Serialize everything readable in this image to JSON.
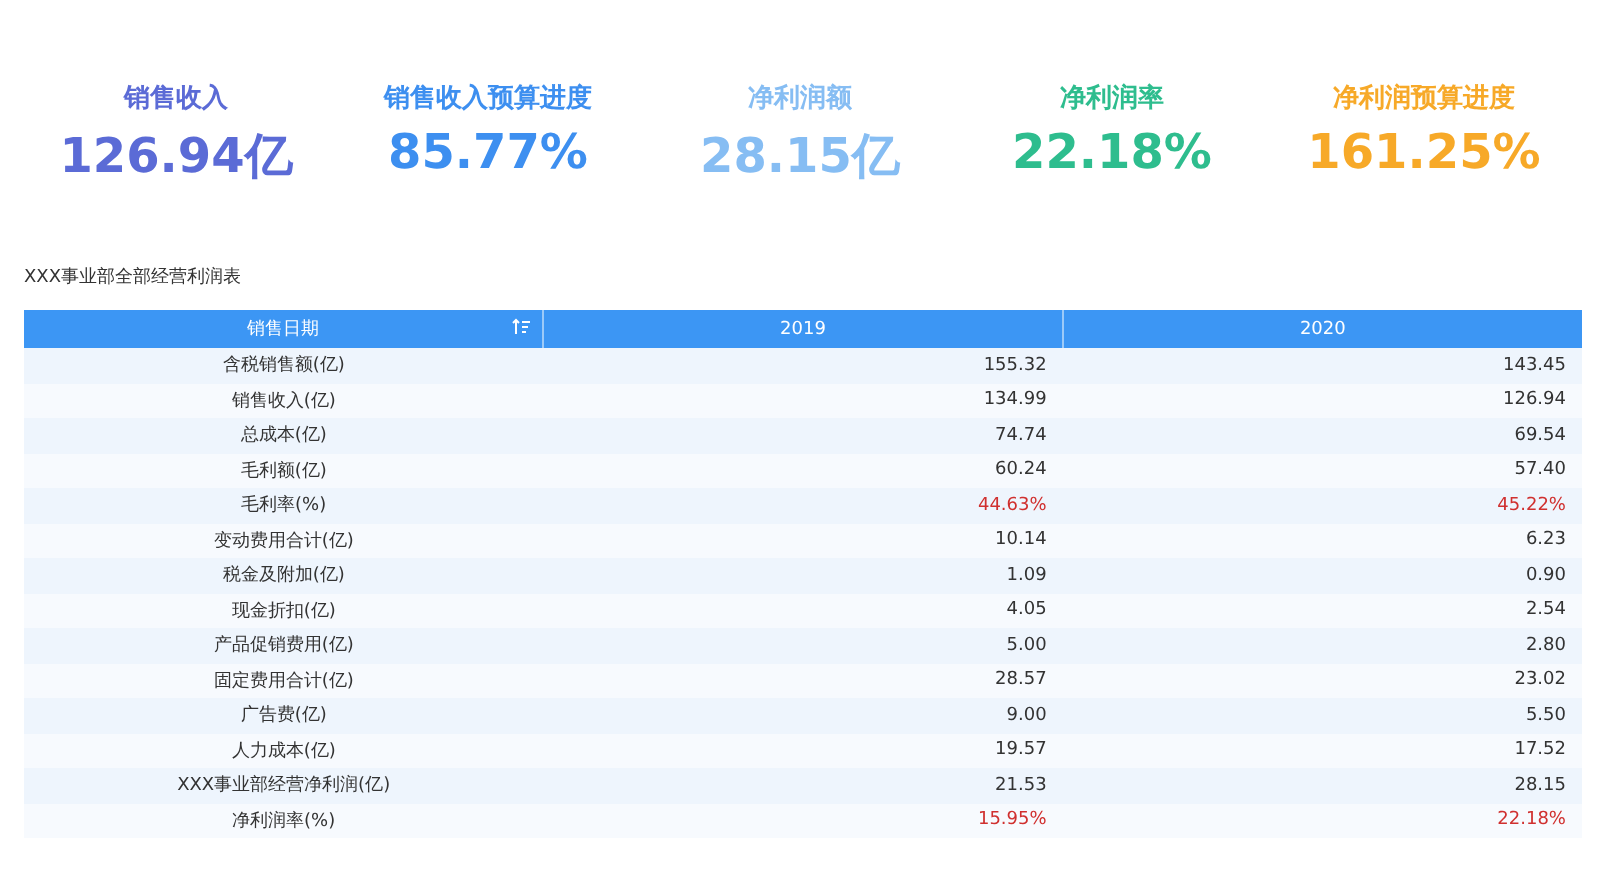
{
  "kpis": [
    {
      "label": "销售收入",
      "value": "126.94亿",
      "color": "#5b6bd6"
    },
    {
      "label": "销售收入预算进度",
      "value": "85.77%",
      "color": "#3d8ff0"
    },
    {
      "label": "净利润额",
      "value": "28.15亿",
      "color": "#86bdf3"
    },
    {
      "label": "净利润率",
      "value": "22.18%",
      "color": "#2ebd8e"
    },
    {
      "label": "净利润预算进度",
      "value": "161.25%",
      "color": "#f7a928"
    }
  ],
  "table": {
    "title": "XXX事业部全部经营利润表",
    "columns": [
      "销售日期",
      "2019",
      "2020"
    ],
    "rows": [
      {
        "cells": [
          "含税销售额(亿)",
          "155.32",
          "143.45"
        ],
        "emphasis": false
      },
      {
        "cells": [
          "销售收入(亿)",
          "134.99",
          "126.94"
        ],
        "emphasis": false
      },
      {
        "cells": [
          "总成本(亿)",
          "74.74",
          "69.54"
        ],
        "emphasis": false
      },
      {
        "cells": [
          "毛利额(亿)",
          "60.24",
          "57.40"
        ],
        "emphasis": false
      },
      {
        "cells": [
          "毛利率(%)",
          "44.63%",
          "45.22%"
        ],
        "emphasis": true
      },
      {
        "cells": [
          "变动费用合计(亿)",
          "10.14",
          "6.23"
        ],
        "emphasis": false
      },
      {
        "cells": [
          "税金及附加(亿)",
          "1.09",
          "0.90"
        ],
        "emphasis": false
      },
      {
        "cells": [
          "现金折扣(亿)",
          "4.05",
          "2.54"
        ],
        "emphasis": false
      },
      {
        "cells": [
          "产品促销费用(亿)",
          "5.00",
          "2.80"
        ],
        "emphasis": false
      },
      {
        "cells": [
          "固定费用合计(亿)",
          "28.57",
          "23.02"
        ],
        "emphasis": false
      },
      {
        "cells": [
          "广告费(亿)",
          "9.00",
          "5.50"
        ],
        "emphasis": false
      },
      {
        "cells": [
          "人力成本(亿)",
          "19.57",
          "17.52"
        ],
        "emphasis": false
      },
      {
        "cells": [
          "XXX事业部经营净利润(亿)",
          "21.53",
          "28.15"
        ],
        "emphasis": false
      },
      {
        "cells": [
          "净利润率(%)",
          "15.95%",
          "22.18%"
        ],
        "emphasis": true
      }
    ]
  }
}
